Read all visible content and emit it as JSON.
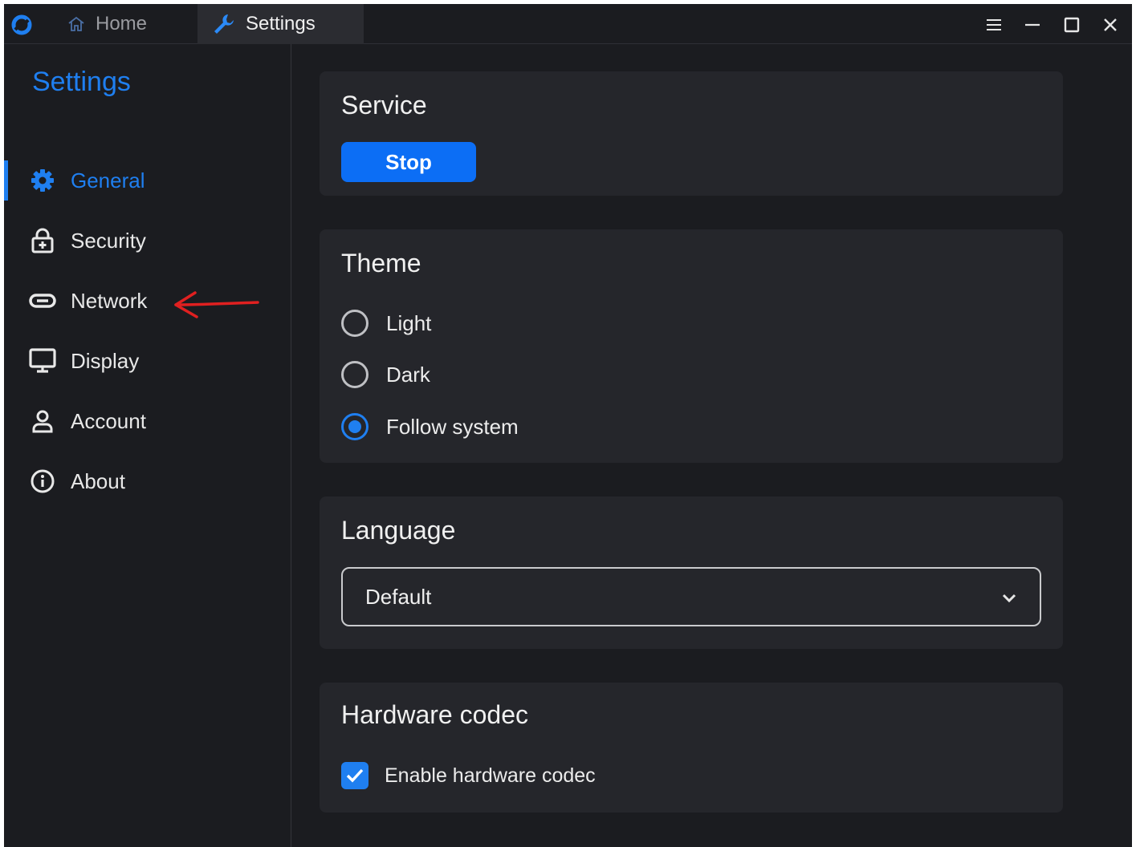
{
  "titlebar": {
    "tabs": [
      {
        "label": "Home",
        "icon": "home-icon"
      },
      {
        "label": "Settings",
        "icon": "wrench-icon"
      }
    ],
    "controls": [
      "menu-icon",
      "minimize-icon",
      "maximize-icon",
      "close-icon"
    ]
  },
  "sidebar": {
    "title": "Settings",
    "items": [
      {
        "label": "General",
        "icon": "gear-icon",
        "active": true
      },
      {
        "label": "Security",
        "icon": "lock-icon"
      },
      {
        "label": "Network",
        "icon": "link-icon"
      },
      {
        "label": "Display",
        "icon": "monitor-icon"
      },
      {
        "label": "Account",
        "icon": "user-icon"
      },
      {
        "label": "About",
        "icon": "info-icon"
      }
    ]
  },
  "main": {
    "service": {
      "title": "Service",
      "button": "Stop"
    },
    "theme": {
      "title": "Theme",
      "options": [
        "Light",
        "Dark",
        "Follow system"
      ],
      "selected": "Follow system"
    },
    "language": {
      "title": "Language",
      "value": "Default"
    },
    "hwcodec": {
      "title": "Hardware codec",
      "checkbox_label": "Enable hardware codec",
      "checked": true
    }
  },
  "colors": {
    "accent": "#1f7ff0",
    "background": "#1b1c20",
    "card": "#25262b",
    "annotation_arrow": "#e02020"
  }
}
